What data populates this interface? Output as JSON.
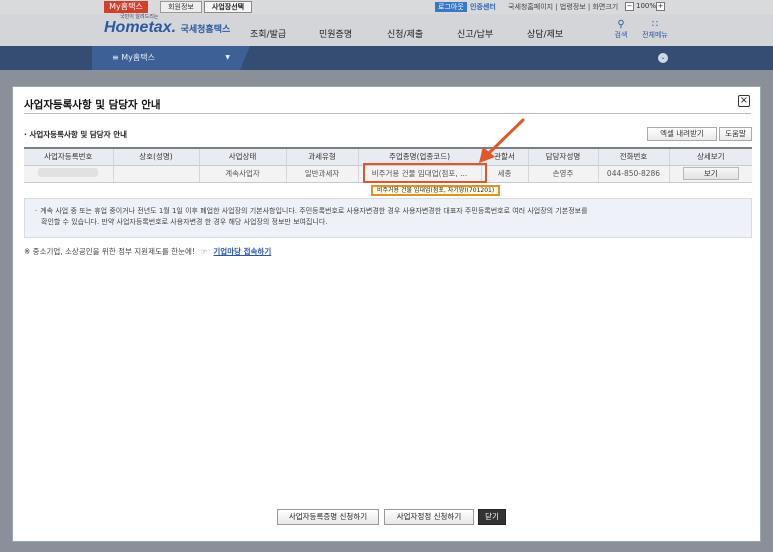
{
  "topbar": {
    "my_hometax": "My홈택스",
    "member_info": "회원정보",
    "biz_select": "사업장선택",
    "login": "로그아웃",
    "cert_center": "인증센터",
    "links": "국세청홈페이지 | 법령정보 | 화면크기",
    "zoom_minus": "−",
    "zoom_value": "100%",
    "zoom_plus": "+"
  },
  "header": {
    "logo_main": "Hometax.",
    "logo_sub": "국세청홈택스",
    "logo_tiny": "국민이 알려드리는",
    "menu": [
      "조회/발급",
      "민원증명",
      "신청/제출",
      "신고/납부",
      "상담/제보"
    ],
    "search_label": "검색",
    "all_menu_label": "전체메뉴"
  },
  "subbar": {
    "my_tab": "My홈택스"
  },
  "modal": {
    "title": "사업자등록사항 및 담당자 안내",
    "section_title": "사업자등록사항 및 담당자 안내",
    "excel_button": "엑셀 내려받기",
    "help_button": "도움말",
    "columns": [
      "사업자등록번호",
      "상호(성명)",
      "사업상태",
      "과세유형",
      "주업종명(업종코드)",
      "관할서",
      "담당자성명",
      "전화번호",
      "상세보기"
    ],
    "rows": [
      {
        "reg_no": "",
        "name": "",
        "status": "계속사업자",
        "tax_type": "일반과세자",
        "industry": "비주거용 건물 임대업(점포, ...",
        "office": "세종",
        "manager": "손영주",
        "phone": "044-850-8286",
        "detail_button": "보기"
      }
    ],
    "tooltip": "비주거용 건물 임대업(점포, 자기땅)(701201)",
    "notice_lines": [
      "계속 사업 중 또는 휴업 중이거나 전년도 1월 1일 이후 폐업한 사업장의 기본사항입니다. 주민등록번호로 사용자변경한 경우 사용자변경한 대표자 주민등록번호로 여러 사업장의 기본정보를",
      "확인할 수 있습니다. 만약 사업자등록번호로 사용자변경 한 경우 해당 사업장의 정보만 보여집니다."
    ],
    "promo_text": "※ 중소기업, 소상공인을 위한 정부 지원제도를 한눈에!",
    "promo_link": "기업마당 접속하기",
    "buttons": {
      "cert": "사업자등록증명 신청하기",
      "fix": "사업자정정 신청하기",
      "close": "닫기"
    }
  },
  "colors": {
    "accent_red": "#d0402b",
    "nav_blue": "#354d73",
    "highlight_orange": "#e0572a"
  },
  "icons": [
    "search-icon",
    "grid-menu-icon",
    "close-icon",
    "arrow-annotation-icon",
    "link-icon"
  ]
}
